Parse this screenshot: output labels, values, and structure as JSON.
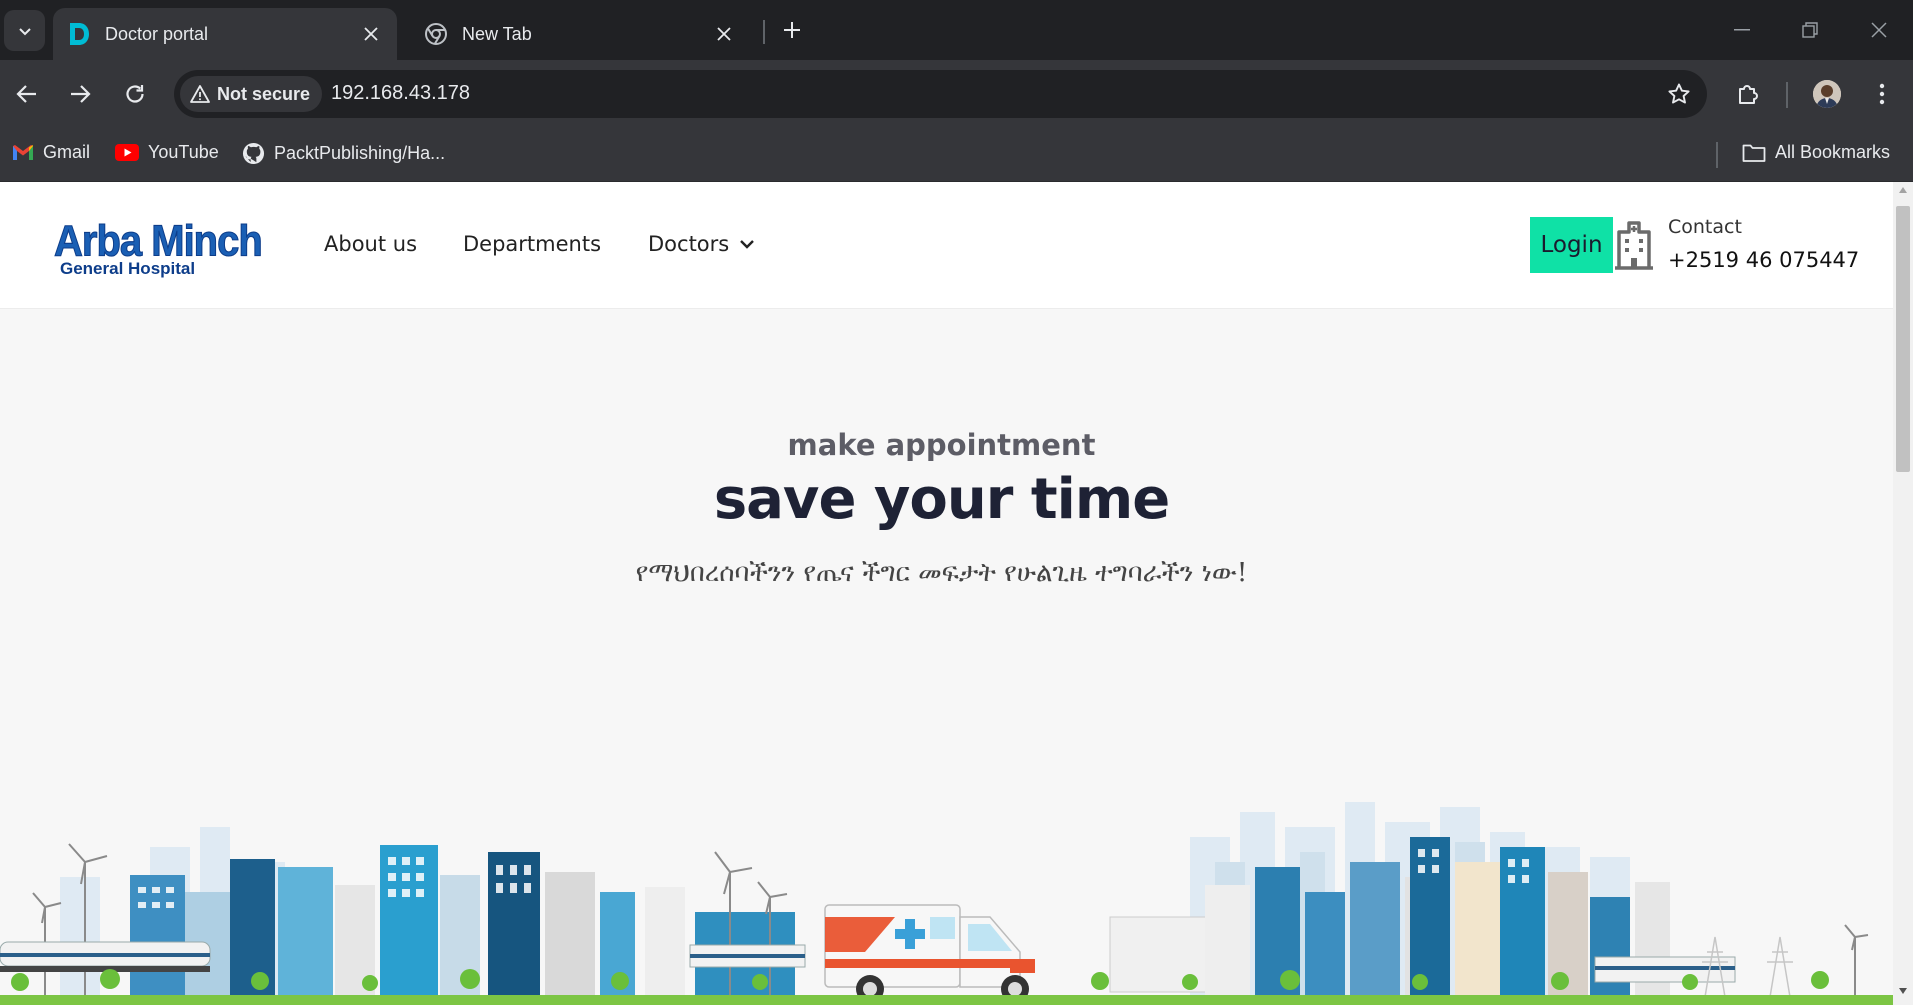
{
  "browser": {
    "tabs": [
      {
        "title": "Doctor portal",
        "favicon": "letter-d-icon",
        "active": true
      },
      {
        "title": "New Tab",
        "favicon": "chrome-icon",
        "active": false
      }
    ],
    "security_label": "Not secure",
    "url": "192.168.43.178",
    "bookmarks": [
      {
        "label": "Gmail",
        "icon": "gmail-icon"
      },
      {
        "label": "YouTube",
        "icon": "youtube-icon"
      },
      {
        "label": "PacktPublishing/Ha...",
        "icon": "github-icon"
      }
    ],
    "all_bookmarks_label": "All Bookmarks",
    "colors": {
      "tabstrip": "#202124",
      "toolbar": "#35363a",
      "favicon_d": "#00bcd4"
    }
  },
  "site": {
    "logo": {
      "line1": "Arba Minch",
      "line2": "General Hospital",
      "color": "#1a5fb4"
    },
    "nav": [
      {
        "label": "About us"
      },
      {
        "label": "Departments"
      },
      {
        "label": "Doctors",
        "has_dropdown": true
      }
    ],
    "login_label": "Login",
    "login_color": "#0fe1a6",
    "contact_label": "Contact",
    "contact_phone": "+2519 46 075447"
  },
  "hero": {
    "kicker": "make appointment",
    "title": "save your time",
    "subtitle": "የማህበረሰባችንን የጤና ችግር መፍታት የሁልጊዜ ተግባራችን ነው!",
    "illustration": "city-skyline-with-ambulance"
  }
}
